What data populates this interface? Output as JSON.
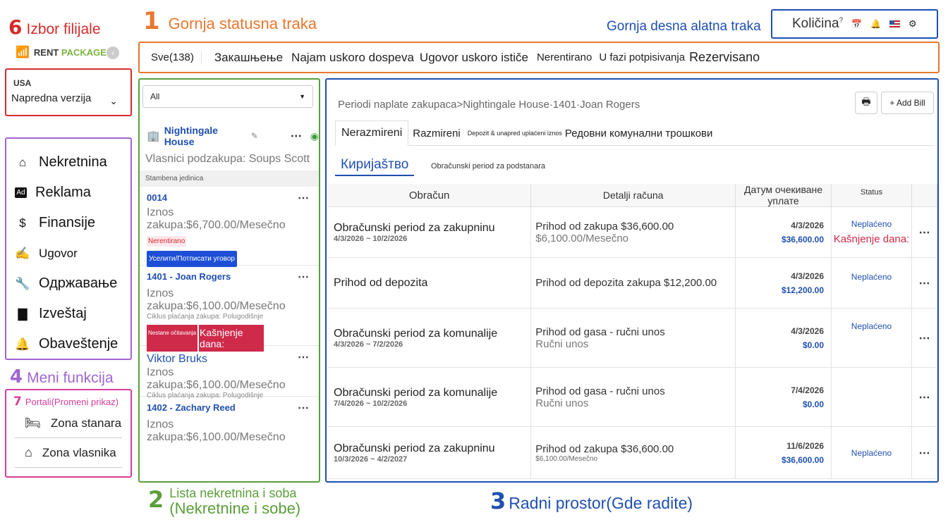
{
  "annotations": {
    "n1": "1",
    "l1": "Gornja statusna traka",
    "n2": "2",
    "l2a": "Lista nekretnina i soba",
    "l2b": "(Nekretnine i sobe)",
    "n3": "3",
    "l3": "Radni prostor(Gde radite)",
    "n4": "4",
    "l4": "Meni funkcija",
    "n6": "6",
    "l6": "Izbor filijale",
    "n7": "7",
    "l7": "Portali(Promeni prikaz)",
    "top_right": "Gornja desna alatna traka"
  },
  "colors": {
    "red": "#d62b2b",
    "orange": "#e8772e",
    "green": "#5a9e3a",
    "purple": "#a066d0",
    "pink": "#d3409c",
    "blue": "#1f4fb0"
  },
  "logo": {
    "text_a": "RENT ",
    "text_b": "PACKAGE",
    "icon": "wifi-logo-icon"
  },
  "branch": {
    "country": "USA",
    "version": "Napredna verzija"
  },
  "menu": [
    {
      "label": "Nekretnina",
      "icon": "home-icon"
    },
    {
      "label": "Reklama",
      "icon": "ad-icon"
    },
    {
      "label": "Finansije",
      "icon": "dollar-icon"
    },
    {
      "label": "Ugovor",
      "icon": "sign-icon"
    },
    {
      "label": "Одржавање",
      "icon": "wrench-icon"
    },
    {
      "label": "Izveštaj",
      "icon": "bar-chart-icon"
    },
    {
      "label": "Obaveštenje",
      "icon": "bell-icon"
    }
  ],
  "portals": [
    {
      "label": "Zona stanara",
      "icon": "bed-icon"
    },
    {
      "label": "Zona vlasnika",
      "icon": "owner-home-icon"
    }
  ],
  "toolbar": {
    "quantity": "Količina",
    "flag": "us-flag-icon"
  },
  "status_tabs": [
    "Sve(138)",
    "Закашњење",
    "Najam uskoro dospeva",
    "Ugovor uskoro ističe",
    "Nerentirano",
    "U fazi potpisivanja",
    "Rezervisano"
  ],
  "property_list": {
    "filter": "All",
    "property_name": "Nightingale House",
    "sublease": "Vlasnici podzakupa: Soups Scott",
    "section": "Stambena jedinica",
    "units": [
      {
        "name": "0014",
        "rent": "Iznos zakupa:$6,700.00/Mesečno",
        "badge": "Nerentirano",
        "action": "Уселити/Потписати уговор"
      },
      {
        "name": "1401 - Joan Rogers",
        "rent": "Iznos zakupa:$6,100.00/Mesečno",
        "cycle": "Ciklus plaćanja zakupa: Polugodišnje",
        "badge1": "Nestane očitavanja",
        "badge2": "Kašnjenje dana:"
      },
      {
        "name": "Viktor Bruks",
        "rent": "Iznos zakupa:$6,100.00/Mesečno",
        "cycle": "Ciklus plaćanja zakupa: Polugodišnje"
      },
      {
        "name": "1402 - Zachary Reed",
        "rent": "Iznos zakupa:$6,100.00/Mesečno"
      }
    ]
  },
  "workspace": {
    "breadcrumb": "Periodi naplate zakupaca>Nightingale House·1401·Joan Rogers",
    "add_bill": "+ Add Bill",
    "tabs": [
      "Nerazmireni",
      "Razmireni",
      "Depozit & unapred uplaćeni iznos",
      "Редовни комунални трошкови"
    ],
    "subtabs": [
      "Киријаšтво",
      "Obračunski period za podstanara"
    ],
    "columns": [
      "Obračun",
      "Detalji računa",
      "Датум очекиване уплате",
      "Status"
    ],
    "rows": [
      {
        "title": "Obračunski period za zakupninu",
        "dates": "4/3/2026 ~ 10/2/2026",
        "detail": "Prihod od zakupa $36,600.00",
        "detail_sub": "$6,100.00/Mesečno",
        "due": "4/3/2026",
        "amount": "$36,600.00",
        "status": "Neplaćeno",
        "late": "Kašnjenje dana:"
      },
      {
        "title": "Prihod od depozita",
        "dates": "",
        "detail": "Prihod od depozita zakupa $12,200.00",
        "detail_sub": "",
        "due": "4/3/2026",
        "amount": "$12,200.00",
        "status": "Neplaćeno",
        "late": ""
      },
      {
        "title": "Obračunski period za komunalije",
        "dates": "4/3/2026 ~ 7/2/2026",
        "detail": "Prihod od gasa - ručni unos",
        "detail_sub": "Ručni unos",
        "due": "4/3/2026",
        "amount": "$0.00",
        "status": "Neplaćeno",
        "late": ""
      },
      {
        "title": "Obračunski period za komunalije",
        "dates": "7/4/2026 ~ 10/2/2026",
        "detail": "Prihod od gasa - ručni unos",
        "detail_sub": "Ručni unos",
        "due": "7/4/2026",
        "amount": "$0.00",
        "status": "",
        "late": ""
      },
      {
        "title": "Obračunski period za zakupninu",
        "dates": "10/3/2026 ~ 4/2/2027",
        "detail": "Prihod od zakupa $36,600.00",
        "detail_sub": "$6,100.00/Mesečno",
        "due": "11/6/2026",
        "amount": "$36,600.00",
        "status": "Neplaćeno",
        "late": ""
      }
    ]
  }
}
